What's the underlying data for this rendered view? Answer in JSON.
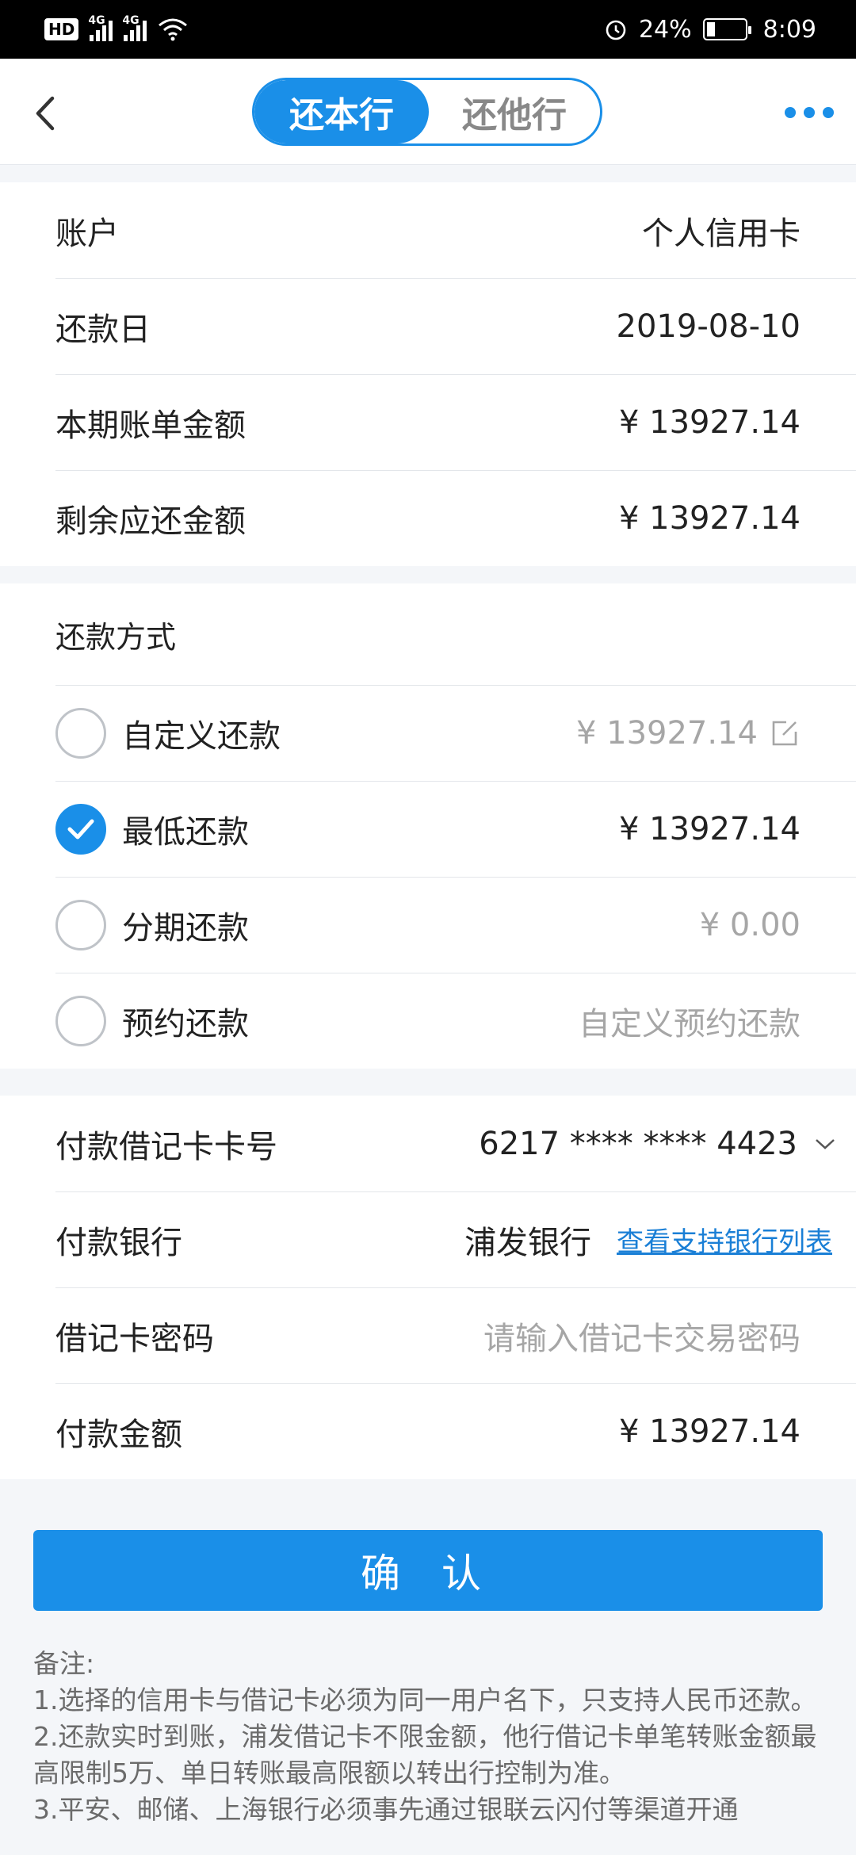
{
  "status_bar": {
    "badge": "HD",
    "net1": "4G",
    "net2": "4G",
    "battery_pct": "24%",
    "time": "8:09"
  },
  "nav": {
    "tabs": [
      {
        "label": "还本行",
        "active": true
      },
      {
        "label": "还他行",
        "active": false
      }
    ]
  },
  "info": {
    "account_label": "账户",
    "account_value": "个人信用卡",
    "due_label": "还款日",
    "due_value": "2019-08-10",
    "bill_label": "本期账单金额",
    "bill_value": "¥ 13927.14",
    "remain_label": "剩余应还金额",
    "remain_value": "¥ 13927.14"
  },
  "method": {
    "title": "还款方式",
    "options": [
      {
        "label": "自定义还款",
        "value": "¥ 13927.14",
        "checked": false
      },
      {
        "label": "最低还款",
        "value": "¥ 13927.14",
        "checked": true
      },
      {
        "label": "分期还款",
        "value": "¥ 0.00",
        "checked": false
      },
      {
        "label": "预约还款",
        "value": "自定义预约还款",
        "checked": false
      }
    ]
  },
  "payment": {
    "card_label": "付款借记卡卡号",
    "card_value": "6217 **** **** 4423",
    "bank_label": "付款银行",
    "bank_value": "浦发银行",
    "bank_link": "查看支持银行列表",
    "pwd_label": "借记卡密码",
    "pwd_placeholder": "请输入借记卡交易密码",
    "amount_label": "付款金额",
    "amount_value": "¥ 13927.14"
  },
  "confirm_label": "确 认",
  "notes": {
    "title": "备注:",
    "lines": [
      "1.选择的信用卡与借记卡必须为同一用户名下，只支持人民币还款。",
      "2.还款实时到账，浦发借记卡不限金额，他行借记卡单笔转账金额最高限制5万、单日转账最高限额以转出行控制为准。",
      "3.平安、邮储、上海银行必须事先通过银联云闪付等渠道开通"
    ]
  },
  "colors": {
    "accent": "#1a8fe8",
    "link": "#1a7fd6"
  }
}
